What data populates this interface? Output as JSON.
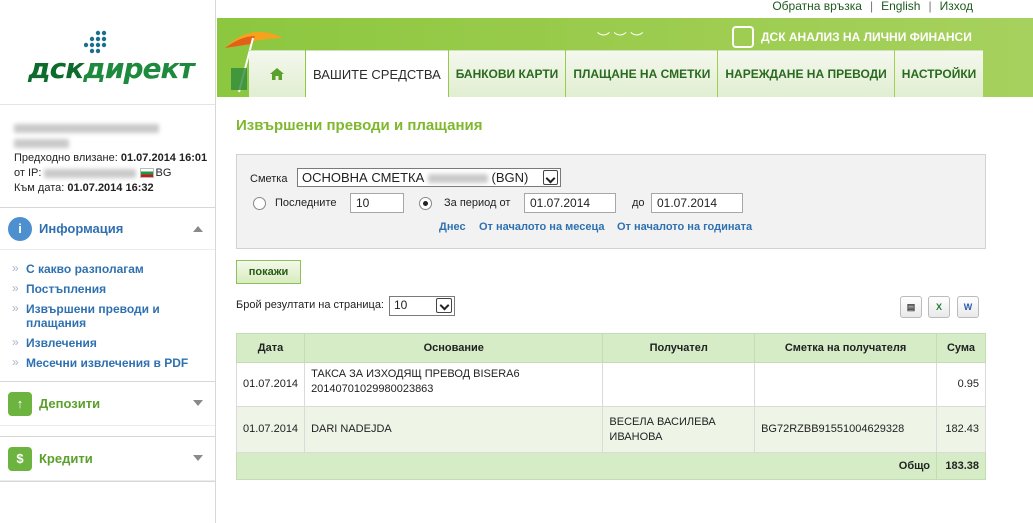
{
  "top_links": {
    "feedback": "Обратна връзка",
    "english": "English",
    "logout": "Изход"
  },
  "logo": {
    "part1": "дск",
    "part2": "директ"
  },
  "analysis_link": "ДСК АНАЛИЗ НА ЛИЧНИ ФИНАНСИ",
  "nav": {
    "tabs": [
      {
        "label": "ВАШИТЕ СРЕДСТВА",
        "active": true
      },
      {
        "label": "БАНКОВИ КАРТИ"
      },
      {
        "label": "ПЛАЩАНЕ НА СМЕТКИ"
      },
      {
        "label": "НАРЕЖДАНЕ НА ПРЕВОДИ"
      },
      {
        "label": "НАСТРОЙКИ"
      }
    ]
  },
  "user": {
    "prev_login_label": "Предходно влизане:",
    "prev_login": "01.07.2014 16:01",
    "ip_label": "от IP:",
    "country": "BG",
    "date_label": "Към дата:",
    "date": "01.07.2014 16:32"
  },
  "sidebar": {
    "info": {
      "title": "Информация",
      "items": [
        "С какво разполагам",
        "Постъпления",
        "Извършени преводи и плащания",
        "Извлечения",
        "Месечни извлечения в PDF"
      ]
    },
    "deposits": {
      "title": "Депозити"
    },
    "credits": {
      "title": "Кредити"
    }
  },
  "page": {
    "title": "Извършени преводи и плащания"
  },
  "filter": {
    "account_label": "Сметка",
    "account_name": "ОСНОВНА СМЕТКА",
    "account_currency": "(BGN)",
    "last_label": "Последните",
    "last_value": "10",
    "period_label": "За период от",
    "from": "01.07.2014",
    "to_label": "до",
    "to": "01.07.2014",
    "links": [
      "Днес",
      "От началото на месеца",
      "От началото на годината"
    ]
  },
  "show_button": "покажи",
  "per_page": {
    "label": "Брой резултати на страница:",
    "value": "10"
  },
  "table": {
    "headers": [
      "Дата",
      "Основание",
      "Получател",
      "Сметка на получателя",
      "Сума"
    ],
    "rows": [
      {
        "date": "01.07.2014",
        "reason": "ТАКСА ЗА ИЗХОДЯЩ ПРЕВОД BISERA6 20140701029980023863",
        "recipient": "",
        "account": "",
        "amount": "0.95"
      },
      {
        "date": "01.07.2014",
        "reason": "DARI NADEJDA",
        "recipient": "ВЕСЕЛА ВАСИЛЕВА ИВАНОВА",
        "account": "BG72RZBB91551004629328",
        "amount": "182.43"
      }
    ],
    "total_label": "Общо",
    "total": "183.38"
  },
  "colors": {
    "brand_green": "#8cc73f",
    "link_blue": "#2f71b0",
    "title_green": "#7fb82d",
    "table_header": "#d5ecc7"
  }
}
